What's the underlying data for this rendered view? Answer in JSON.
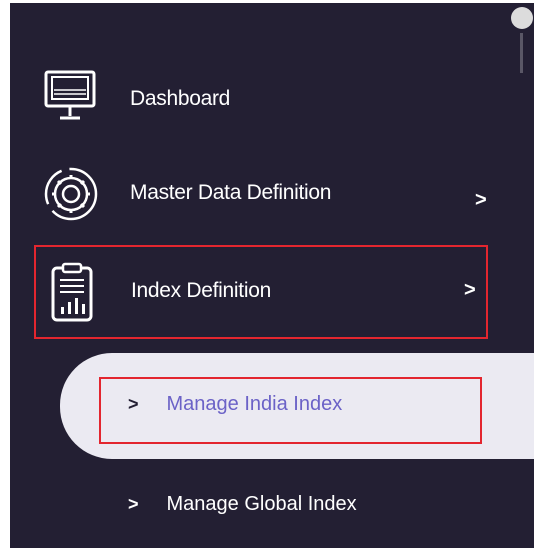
{
  "sidebar": {
    "items": [
      {
        "label": "Dashboard",
        "icon": "monitor-icon"
      },
      {
        "label": "Master Data Definition",
        "icon": "gear-icon",
        "chevron": ">"
      },
      {
        "label": "Index Definition",
        "icon": "clipboard-chart-icon",
        "chevron": ">",
        "highlighted": true
      }
    ],
    "sub_items": [
      {
        "label": "Manage India Index",
        "chevron": ">",
        "active": true
      },
      {
        "label": "Manage Global Index",
        "chevron": ">"
      }
    ]
  },
  "colors": {
    "sidebar_bg": "#231f33",
    "active_bg": "#ebeaf2",
    "active_text": "#6b62c7",
    "highlight_border": "#e3262f"
  }
}
